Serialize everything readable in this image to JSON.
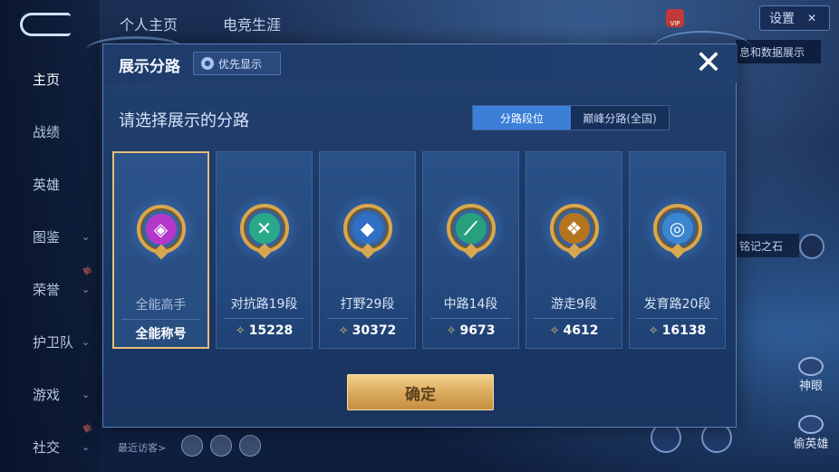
{
  "background": {
    "back_label": "",
    "top_tabs": [
      "个人主页",
      "电竞生涯"
    ],
    "settings_label": "设置",
    "right_strip_text": "息和数据展示",
    "right_strip2_text": "铭记之石",
    "side_actions": [
      "神眼",
      "偷英雄"
    ],
    "recent_visitors_label": "最近访客>"
  },
  "sidebar": {
    "items": [
      {
        "label": "主页",
        "chevron": ""
      },
      {
        "label": "战绩",
        "chevron": ""
      },
      {
        "label": "英雄",
        "chevron": ""
      },
      {
        "label": "图鉴",
        "chevron": "⌄"
      },
      {
        "label": "荣誉",
        "chevron": "⌄"
      },
      {
        "label": "护卫队",
        "chevron": "⌄"
      },
      {
        "label": "游戏",
        "chevron": "⌄"
      },
      {
        "label": "社交",
        "chevron": "⌄"
      }
    ],
    "new_badge": "新"
  },
  "modal": {
    "title": "展示分路",
    "priority_label": "优先显示",
    "close_glyph": "✕",
    "prompt": "请选择展示的分路",
    "segments": {
      "active": "分路段位",
      "inactive": "巅峰分路(全国)"
    },
    "cards": [
      {
        "rank": "全能高手",
        "score": "全能称号",
        "score_has_icon": false,
        "medal_color": "#b438c9",
        "glyph": "◈",
        "selected": true
      },
      {
        "rank": "对抗路19段",
        "score": "15228",
        "score_has_icon": true,
        "medal_color": "#2aa98a",
        "glyph": "✕",
        "selected": false
      },
      {
        "rank": "打野29段",
        "score": "30372",
        "score_has_icon": true,
        "medal_color": "#2f6fc4",
        "glyph": "◆",
        "selected": false
      },
      {
        "rank": "中路14段",
        "score": "9673",
        "score_has_icon": true,
        "medal_color": "#27a07e",
        "glyph": "⟋",
        "selected": false
      },
      {
        "rank": "游走9段",
        "score": "4612",
        "score_has_icon": true,
        "medal_color": "#b5751f",
        "glyph": "❖",
        "selected": false
      },
      {
        "rank": "发育路20段",
        "score": "16138",
        "score_has_icon": true,
        "medal_color": "#3a86cf",
        "glyph": "◎",
        "selected": false
      }
    ],
    "confirm_label": "确定"
  },
  "colors": {
    "accent_gold": "#e8bd7a",
    "segment_active": "#3b7fd9"
  }
}
